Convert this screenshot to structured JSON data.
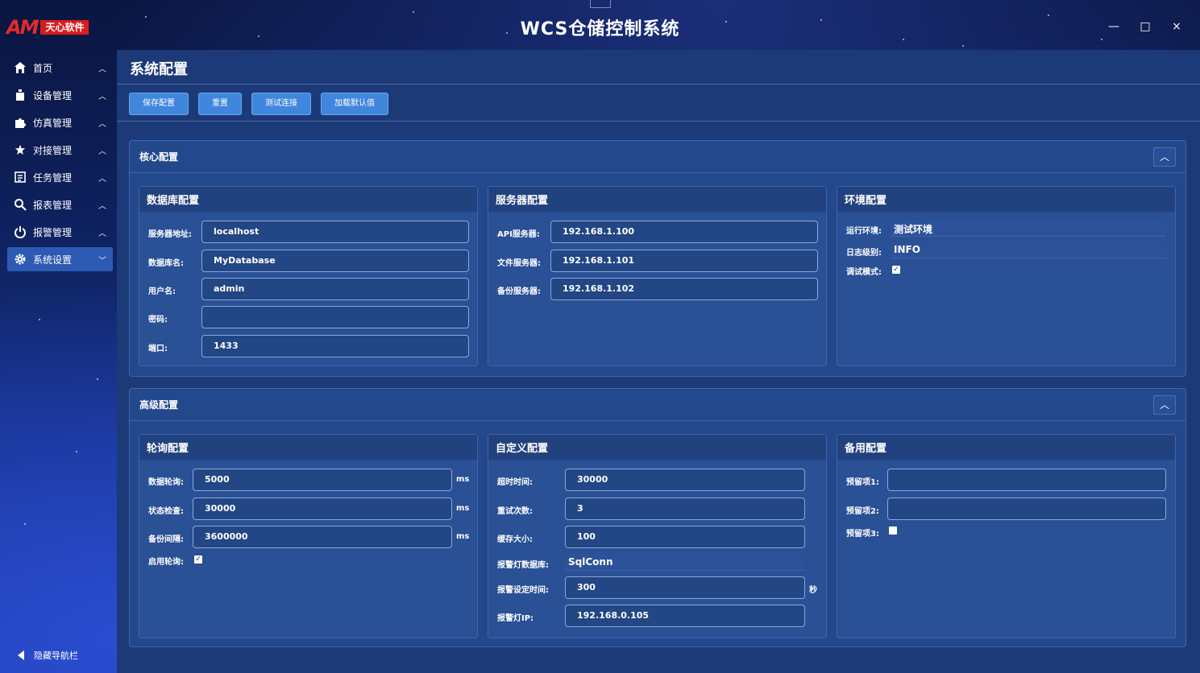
{
  "window": {
    "logo_mark": "AM",
    "logo_text": "天心软件",
    "title": "WCS仓储控制系统",
    "minimize": "—",
    "maximize": "□",
    "close": "×"
  },
  "sidebar": {
    "items": [
      {
        "label": "首页",
        "icon": "home-icon"
      },
      {
        "label": "设备管理",
        "icon": "device-icon"
      },
      {
        "label": "仿真管理",
        "icon": "puzzle-icon"
      },
      {
        "label": "对接管理",
        "icon": "star-icon"
      },
      {
        "label": "任务管理",
        "icon": "task-list-icon"
      },
      {
        "label": "报表管理",
        "icon": "search-icon"
      },
      {
        "label": "报警管理",
        "icon": "power-icon"
      },
      {
        "label": "系统设置",
        "icon": "gear-icon"
      }
    ],
    "active_index": 7,
    "hide_label": "隐藏导航栏"
  },
  "page": {
    "title": "系统配置",
    "toolbar": {
      "save": "保存配置",
      "reset": "重置",
      "test": "测试连接",
      "defaults": "加载默认值"
    }
  },
  "core": {
    "title": "核心配置",
    "database": {
      "title": "数据库配置",
      "server_label": "服务器地址:",
      "server": "localhost",
      "dbname_label": "数据库名:",
      "dbname": "MyDatabase",
      "user_label": "用户名:",
      "user": "admin",
      "password_label": "密码:",
      "password": "",
      "port_label": "端口:",
      "port": "1433"
    },
    "server": {
      "title": "服务器配置",
      "api_label": "API服务器:",
      "api": "192.168.1.100",
      "file_label": "文件服务器:",
      "file": "192.168.1.101",
      "backup_label": "备份服务器:",
      "backup": "192.168.1.102"
    },
    "env": {
      "title": "环境配置",
      "run_label": "运行环境:",
      "run": "测试环境",
      "log_label": "日志级别:",
      "log": "INFO",
      "debug_label": "调试模式:",
      "debug": true
    }
  },
  "advanced": {
    "title": "高级配置",
    "polling": {
      "title": "轮询配置",
      "data_label": "数据轮询:",
      "data": "5000",
      "status_label": "状态检查:",
      "status": "30000",
      "backup_label": "备份间隔:",
      "backup": "3600000",
      "unit": "ms",
      "enable_label": "启用轮询:",
      "enable": true
    },
    "custom": {
      "title": "自定义配置",
      "timeout_label": "超时时间:",
      "timeout": "30000",
      "retry_label": "重试次数:",
      "retry": "3",
      "cache_label": "缓存大小:",
      "cache": "100",
      "alarm_db_label": "报警灯数据库:",
      "alarm_db": "SqlConn",
      "alarm_time_label": "报警设定时间:",
      "alarm_time": "300",
      "alarm_time_unit": "秒",
      "alarm_ip_label": "报警灯IP:",
      "alarm_ip": "192.168.0.105"
    },
    "spare": {
      "title": "备用配置",
      "r1_label": "预留项1:",
      "r1": "",
      "r2_label": "预留项2:",
      "r2": "",
      "r3_label": "预留项3:",
      "r3": false
    }
  }
}
